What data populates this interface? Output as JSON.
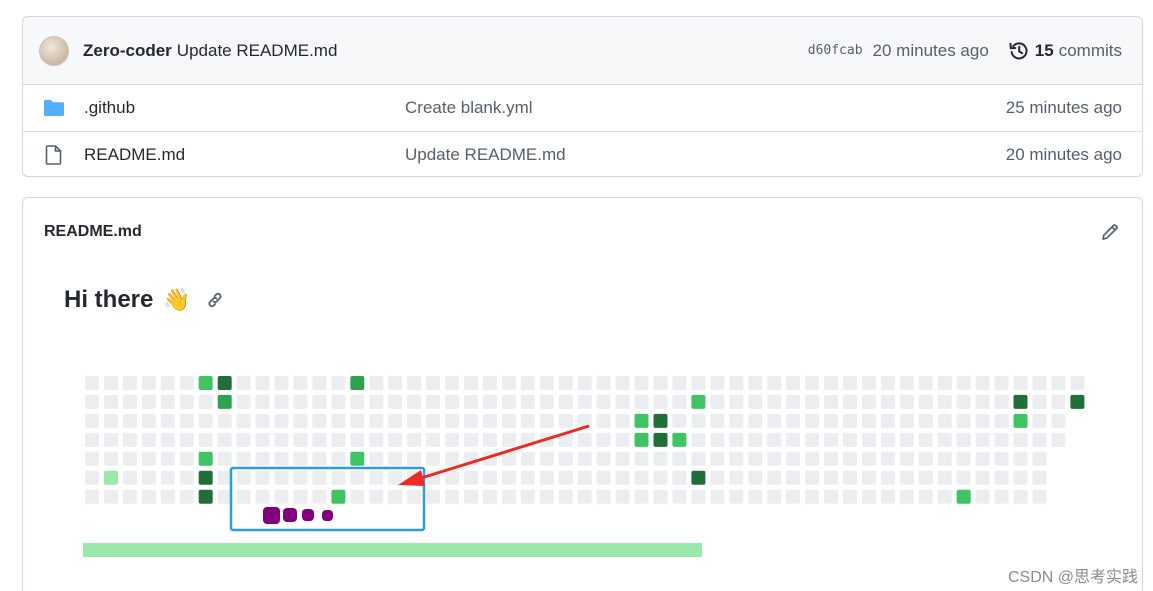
{
  "commit_bar": {
    "author": "Zero-coder",
    "message": "Update README.md",
    "sha": "d60fcab",
    "time": "20 minutes ago",
    "commits_count": "15",
    "commits_label": "commits"
  },
  "files": [
    {
      "name": ".github",
      "type": "folder",
      "commit": "Create blank.yml",
      "time": "25 minutes ago"
    },
    {
      "name": "README.md",
      "type": "file",
      "commit": "Update README.md",
      "time": "20 minutes ago"
    }
  ],
  "readme": {
    "title": "README.md",
    "heading": "Hi there",
    "emoji": "👋"
  },
  "contribution_graph": {
    "levels": {
      "empty": "#ebedf0",
      "l1": "#9be9a8",
      "l2": "#40c463",
      "l3": "#30a14e",
      "l4": "#216e39"
    },
    "annotation_colors": {
      "box": "#2b9be3",
      "arrow": "#ee2a24",
      "dots": "#800080"
    }
  },
  "watermark": "CSDN @思考实践"
}
